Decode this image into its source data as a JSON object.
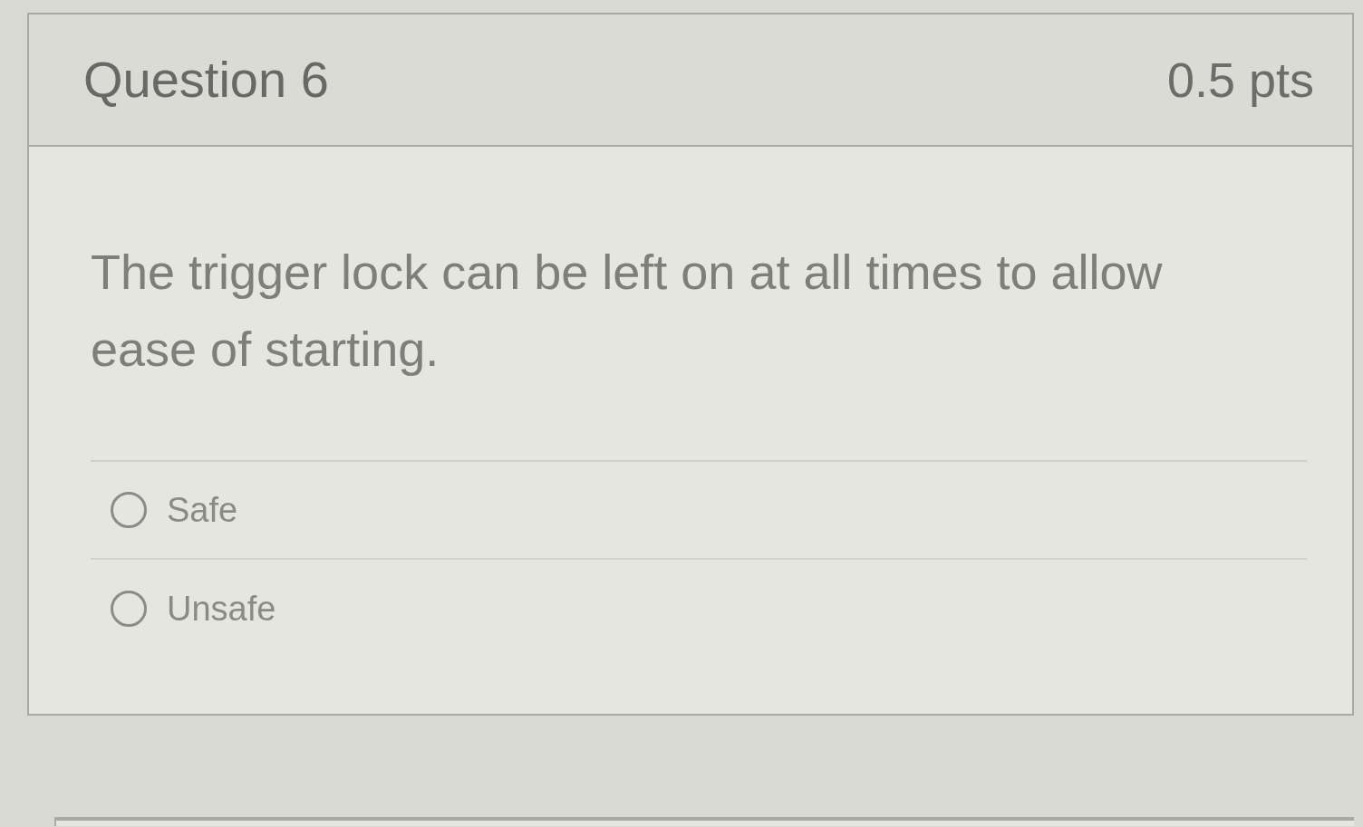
{
  "question": {
    "title": "Question 6",
    "points": "0.5 pts",
    "text": "The trigger lock can be left on at all times to allow ease of starting."
  },
  "answers": [
    {
      "label": "Safe",
      "selected": false
    },
    {
      "label": "Unsafe",
      "selected": false
    }
  ]
}
